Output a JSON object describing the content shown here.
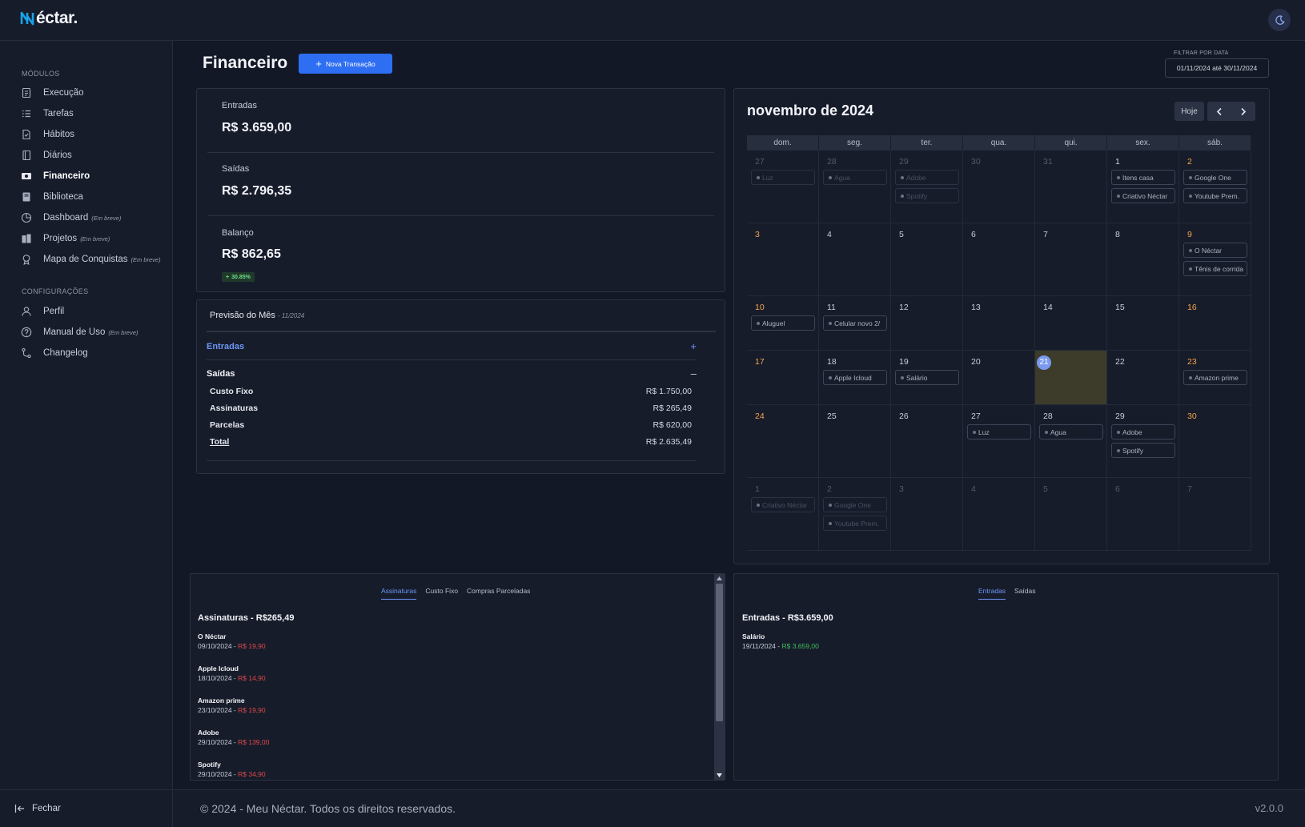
{
  "app": {
    "logo_text": "éctar.",
    "logo_mark": "N"
  },
  "sidebar": {
    "modules_title": "MÓDULOS",
    "modules": [
      {
        "label": "Execução",
        "icon": "execution-icon",
        "soon": ""
      },
      {
        "label": "Tarefas",
        "icon": "tasks-icon",
        "soon": ""
      },
      {
        "label": "Hábitos",
        "icon": "habits-icon",
        "soon": ""
      },
      {
        "label": "Diários",
        "icon": "journal-icon",
        "soon": ""
      },
      {
        "label": "Financeiro",
        "icon": "finance-icon",
        "soon": "",
        "active": true
      },
      {
        "label": "Biblioteca",
        "icon": "library-icon",
        "soon": ""
      },
      {
        "label": "Dashboard",
        "icon": "dashboard-icon",
        "soon": "(Em breve)"
      },
      {
        "label": "Projetos",
        "icon": "projects-icon",
        "soon": "(Em breve)"
      },
      {
        "label": "Mapa de Conquistas",
        "icon": "achievements-icon",
        "soon": "(Em breve)"
      }
    ],
    "settings_title": "CONFIGURAÇÕES",
    "settings": [
      {
        "label": "Perfil",
        "icon": "profile-icon",
        "soon": ""
      },
      {
        "label": "Manual de Uso",
        "icon": "help-icon",
        "soon": "(Em breve)"
      },
      {
        "label": "Changelog",
        "icon": "changelog-icon",
        "soon": ""
      }
    ],
    "close_label": "Fechar"
  },
  "header": {
    "title": "Financeiro",
    "new_button": "Nova Transação",
    "filter_label": "FILTRAR POR DATA",
    "filter_value": "01/11/2024 até 30/11/2024"
  },
  "summary": {
    "entradas_label": "Entradas",
    "entradas_value": "R$ 3.659,00",
    "saidas_label": "Saídas",
    "saidas_value": "R$ 2.796,35",
    "balanco_label": "Balanço",
    "balanco_value": "R$ 862,65",
    "balanco_badge": "30.85%"
  },
  "forecast": {
    "title": "Previsão do Mês",
    "period": "- 11/2024",
    "entradas_label": "Entradas",
    "entradas_toggle": "+",
    "saidas_label": "Saídas",
    "saidas_toggle": "–",
    "rows": [
      {
        "label": "Custo Fixo",
        "value": "R$ 1.750,00"
      },
      {
        "label": "Assinaturas",
        "value": "R$ 265,49"
      },
      {
        "label": "Parcelas",
        "value": "R$ 620,00"
      }
    ],
    "total_label": "Total",
    "total_value": "R$ 2.635,49"
  },
  "calendar": {
    "title": "novembro de 2024",
    "today_button": "Hoje",
    "weekdays": [
      "dom.",
      "seg.",
      "ter.",
      "qua.",
      "qui.",
      "sex.",
      "sáb."
    ],
    "weeks": [
      [
        {
          "d": "27",
          "out": true,
          "ev": [
            "Luz"
          ]
        },
        {
          "d": "28",
          "out": true,
          "ev": [
            "Agua"
          ]
        },
        {
          "d": "29",
          "out": true,
          "ev": [
            "Adobe",
            "Spotify"
          ]
        },
        {
          "d": "30",
          "out": true,
          "ev": []
        },
        {
          "d": "31",
          "out": true,
          "ev": []
        },
        {
          "d": "1",
          "ev": [
            "Itens casa",
            "Criativo Néctar"
          ]
        },
        {
          "d": "2",
          "ev": [
            "Google One",
            "Youtube Prem."
          ]
        }
      ],
      [
        {
          "d": "3",
          "ev": []
        },
        {
          "d": "4",
          "ev": []
        },
        {
          "d": "5",
          "ev": []
        },
        {
          "d": "6",
          "ev": []
        },
        {
          "d": "7",
          "ev": []
        },
        {
          "d": "8",
          "ev": []
        },
        {
          "d": "9",
          "ev": [
            "O Néctar",
            "Tênis de corrida"
          ]
        }
      ],
      [
        {
          "d": "10",
          "ev": [
            "Aluguel"
          ]
        },
        {
          "d": "11",
          "ev": [
            "Celular novo 2/"
          ]
        },
        {
          "d": "12",
          "ev": []
        },
        {
          "d": "13",
          "ev": []
        },
        {
          "d": "14",
          "ev": []
        },
        {
          "d": "15",
          "ev": []
        },
        {
          "d": "16",
          "ev": []
        }
      ],
      [
        {
          "d": "17",
          "ev": []
        },
        {
          "d": "18",
          "ev": [
            "Apple Icloud"
          ]
        },
        {
          "d": "19",
          "ev": [
            "Salário"
          ]
        },
        {
          "d": "20",
          "ev": []
        },
        {
          "d": "21",
          "today": true,
          "ev": []
        },
        {
          "d": "22",
          "ev": []
        },
        {
          "d": "23",
          "ev": [
            "Amazon prime"
          ]
        }
      ],
      [
        {
          "d": "24",
          "ev": []
        },
        {
          "d": "25",
          "ev": []
        },
        {
          "d": "26",
          "ev": []
        },
        {
          "d": "27",
          "ev": [
            "Luz"
          ]
        },
        {
          "d": "28",
          "ev": [
            "Agua"
          ]
        },
        {
          "d": "29",
          "ev": [
            "Adobe",
            "Spotify"
          ]
        },
        {
          "d": "30",
          "ev": []
        }
      ],
      [
        {
          "d": "1",
          "out": true,
          "ev": [
            "Criativo Néctar"
          ]
        },
        {
          "d": "2",
          "out": true,
          "ev": [
            "Google One",
            "Youtube Prem."
          ]
        },
        {
          "d": "3",
          "out": true,
          "ev": []
        },
        {
          "d": "4",
          "out": true,
          "ev": []
        },
        {
          "d": "5",
          "out": true,
          "ev": []
        },
        {
          "d": "6",
          "out": true,
          "ev": []
        },
        {
          "d": "7",
          "out": true,
          "ev": []
        }
      ]
    ]
  },
  "expenses_panel": {
    "tabs": [
      "Assinaturas",
      "Custo Fixo",
      "Compras Parceladas"
    ],
    "title": "Assinaturas - R$265,49",
    "items": [
      {
        "name": "O Néctar",
        "date": "09/10/2024",
        "amount": "R$ 19,90"
      },
      {
        "name": "Apple Icloud",
        "date": "18/10/2024",
        "amount": "R$ 14,90"
      },
      {
        "name": "Amazon prime",
        "date": "23/10/2024",
        "amount": "R$ 19,90"
      },
      {
        "name": "Adobe",
        "date": "29/10/2024",
        "amount": "R$ 139,00"
      },
      {
        "name": "Spotify",
        "date": "29/10/2024",
        "amount": "R$ 34,90"
      }
    ]
  },
  "income_panel": {
    "tabs": [
      "Entradas",
      "Saídas"
    ],
    "title": "Entradas - R$3.659,00",
    "items": [
      {
        "name": "Salário",
        "date": "19/11/2024",
        "amount": "R$ 3.659,00"
      }
    ]
  },
  "footer": {
    "copyright": "© 2024 - Meu Néctar. Todos os direitos reservados.",
    "version": "v2.0.0"
  },
  "colors": {
    "accent": "#2e6ef2",
    "tab_active": "#6d95f5",
    "negative": "#e04848",
    "positive": "#3fbf5f",
    "weekend": "#f2a34a",
    "today_bg": "#3d3b29"
  }
}
